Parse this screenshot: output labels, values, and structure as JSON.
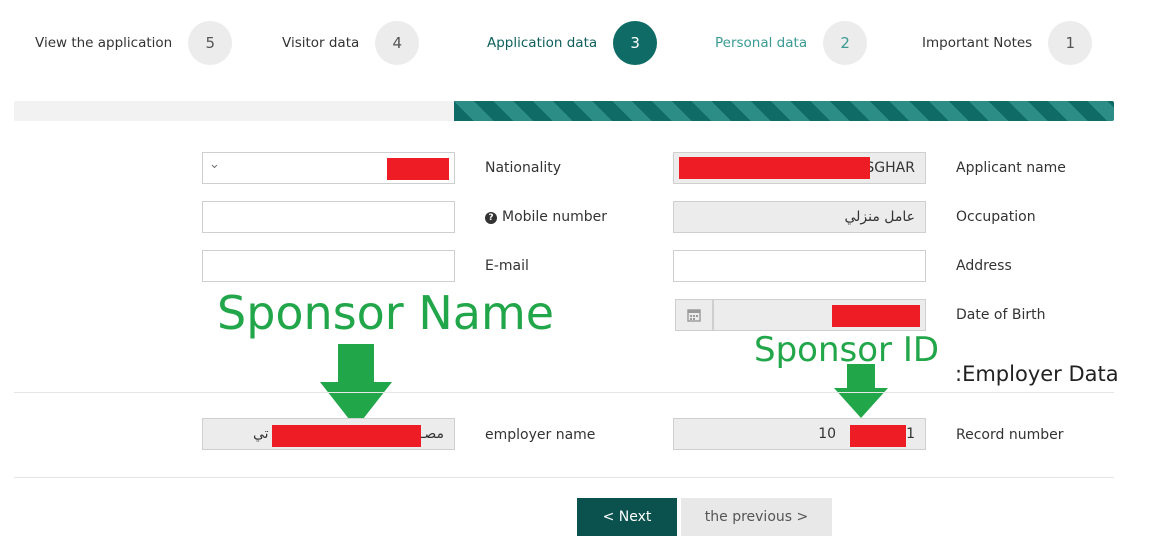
{
  "steps": [
    {
      "number": "5",
      "label": "View the application",
      "state": "pending"
    },
    {
      "number": "4",
      "label": "Visitor data",
      "state": "pending"
    },
    {
      "number": "3",
      "label": "Application data",
      "state": "active"
    },
    {
      "number": "2",
      "label": "Personal data",
      "state": "done"
    },
    {
      "number": "1",
      "label": "Important Notes",
      "state": "pending"
    }
  ],
  "progress": {
    "fraction": 0.6
  },
  "form": {
    "nationality_label": "Nationality",
    "nationality_chevron": "⌄",
    "applicant_name_label": "Applicant name",
    "applicant_name_value": "SGHAR",
    "mobile_label": "Mobile number",
    "mobile_value": "",
    "occupation_label": "Occupation",
    "occupation_value": "عامل منزلي",
    "email_label": "E-mail",
    "email_value": "",
    "address_label": "Address",
    "address_value": "",
    "dob_label": "Date of Birth",
    "employer_section_title": ":Employer Data",
    "employer_name_label": "employer name",
    "employer_name_value_right": "مصـ",
    "employer_name_value_left": "تي",
    "record_number_label": "Record number",
    "record_number_prefix": "10",
    "record_number_suffix": "1"
  },
  "annotations": {
    "sponsor_name": "Sponsor Name",
    "sponsor_id": "Sponsor ID",
    "color": "#22a64a"
  },
  "buttons": {
    "next": "< Next",
    "previous": "the previous >"
  },
  "colors": {
    "accent": "#0e6b66",
    "redaction": "#ee1c25"
  },
  "icons": {
    "calendar": "calendar-icon",
    "help": "question-circle-icon",
    "chevron": "chevron-down-icon"
  }
}
